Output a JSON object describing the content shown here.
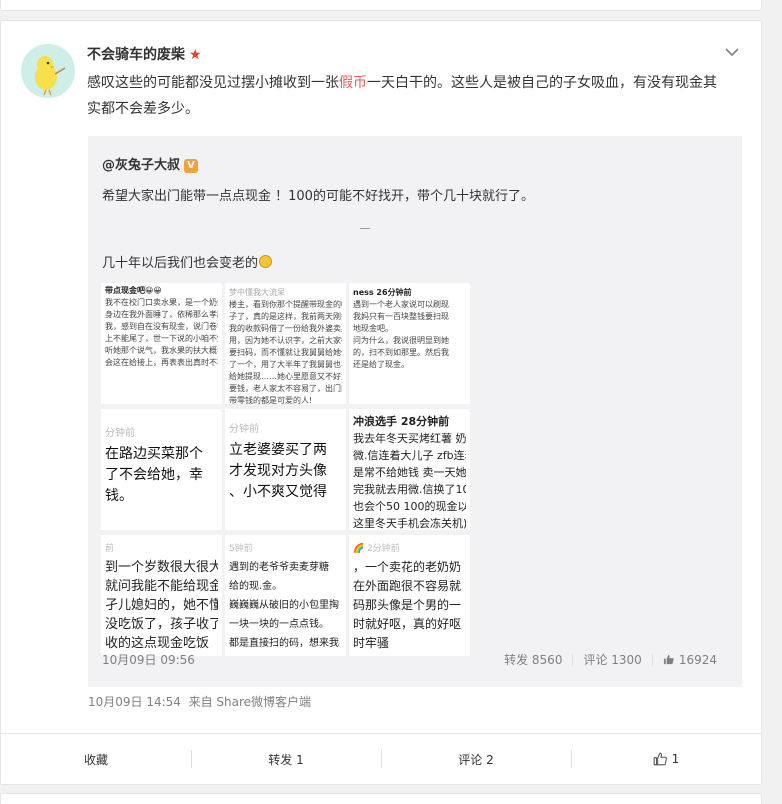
{
  "post": {
    "author": "不会骑车的废柴",
    "text_before": "感叹这些的可能都没见过摆小摊收到一张",
    "text_highlight": "假币",
    "text_after": "一天白干的。这些人是被自己的子女吸血，有没有现金其实都不会差多少。",
    "time": "10月09日 14:54",
    "source": "来自 Share微博客户端"
  },
  "quote": {
    "author": "@灰兔子大叔",
    "verified_badge": "V",
    "text": "希望大家出门能带一点点现金 ！100的可能不好找开，带个几十块就行了。",
    "divider": "—",
    "text2": "几十年以后我们也会变老的",
    "time": "10月09日 09:56",
    "stats": {
      "repost_label": "转发 8560",
      "comment_label": "评论 1300",
      "like_count": "16924"
    },
    "images": [
      {
        "lines": [
          "带点现金吧😀😀",
          "",
          "我不在校门口卖水果，是一个奶奶，孩子在",
          "身边在我外面睡了，依稀那么孝顺的可爱",
          "我，感到自在没有现金，说门卷钱没着多",
          "上不能尾了，世一下说的小咱不知这样以现",
          "",
          "听她那个说气，我水果的扶大概年见子也不",
          "会这在给接上，再表表出真时不容易子"
        ]
      },
      {
        "lines": [
          "梦中懂我大流呆",
          "",
          "楼主，看到你那个提醒带现金的帖",
          "子了，真的是这样，我前两天刚把",
          "我的收款码借了一份给我外婆卖菜",
          "用，因为她不认识字，之前大家都",
          "要扫码，而不懂就让我舅舅给她做",
          "了一个，用了大半年了我舅舅也不",
          "给她提现……她心里愿意又不好意思",
          "要钱，老人家太不容易了，出门能",
          "带零钱的都是可爱的人!"
        ]
      },
      {
        "lines": [
          "ness 26分钟前",
          "遇到一个老人家说可以刷现",
          "我妈只有一百块整钱要扫现",
          "地现金吧。",
          "",
          "问为什么，我说很明显到她",
          "的，扫不到如那里。然后我",
          "还是给了现金。"
        ]
      },
      {
        "lines": [
          "分钟前",
          "在路边买菜那个",
          "了不会给她，幸",
          "钱。"
        ]
      },
      {
        "lines": [
          "分钟前",
          "立老婆婆买了两",
          "才发现对方头像",
          "、小不爽又觉得"
        ]
      },
      {
        "lines": [
          "冲浪选手 28分钟前",
          "我去年冬天买烤红薯 奶",
          "微.信连着大儿子 zfb连着",
          "是常不给她钱 卖一天她也",
          "完我就去用微.信换了10",
          "也会个50 100的现金以",
          "这里冬天手机会冻关机)"
        ]
      },
      {
        "lines": [
          "前",
          "到一个岁数很大很大的",
          "就问我能不能给现金",
          "孑儿媳妇的，她不懂这",
          "没吃饭了，孩子收了钱",
          "收的这点现金吃饭"
        ]
      },
      {
        "lines": [
          "5钟前",
          "遇到的老爷爷卖麦芽糖",
          "给的现.金。",
          "巍巍巍从破旧的小包里掏",
          "一块一块的一点点钱。",
          "都是直接扫的码，想来我"
        ]
      },
      {
        "lines": [
          "🌈 2分钟前",
          "，一个卖花的老奶奶",
          "在外面跑很不容易就",
          "码那头像是个男的一",
          "时就好呕，真的好呕",
          "时牢骚"
        ]
      }
    ]
  },
  "actions": {
    "favorite": "收藏",
    "repost": "转发 1",
    "comment": "评论 2",
    "like": "1"
  },
  "colors": {
    "highlight": "#eb5c5c",
    "meta": "#808080",
    "quote_bg": "#f2f2f5",
    "star": "#e8402f",
    "vip_badge": "#f2a23c"
  },
  "icons": [
    "chevron-down-icon",
    "star-icon",
    "vip-badge-icon",
    "smile-emoji-icon",
    "thumbs-up-icon"
  ]
}
